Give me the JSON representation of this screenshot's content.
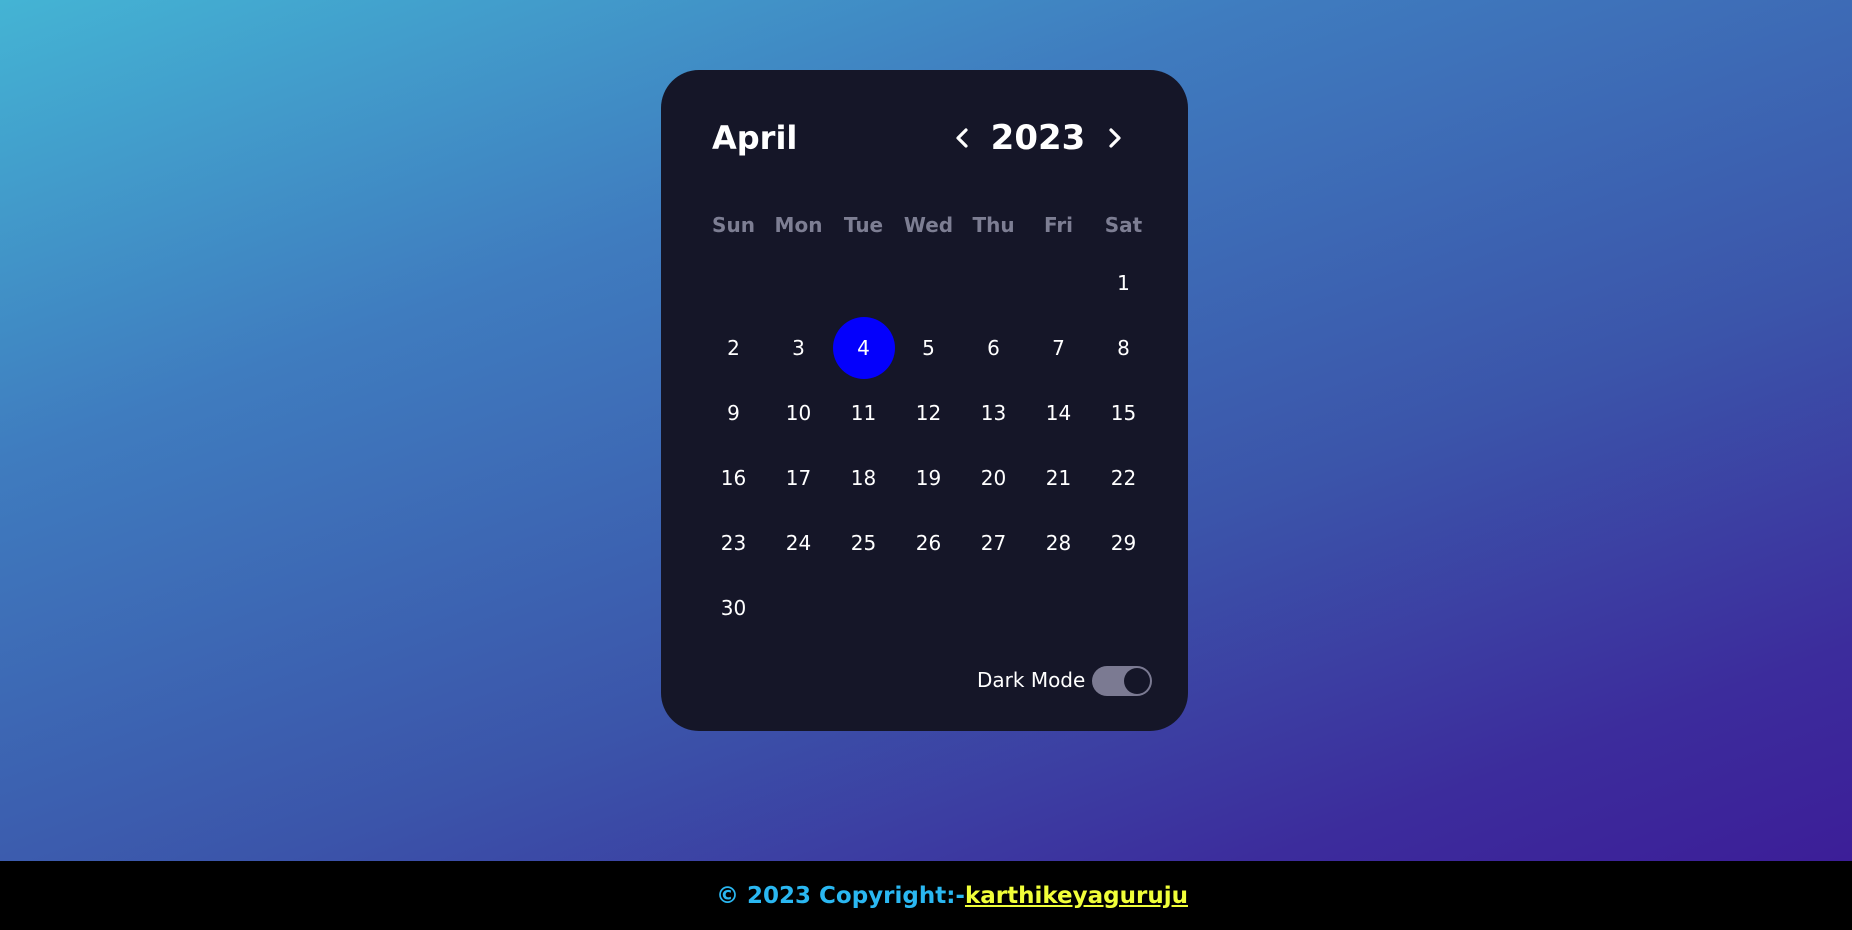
{
  "calendar": {
    "month": "April",
    "year": "2023",
    "prev_icon": "chevron-left-icon",
    "next_icon": "chevron-right-icon",
    "weekdays": [
      "Sun",
      "Mon",
      "Tue",
      "Wed",
      "Thu",
      "Fri",
      "Sat"
    ],
    "weeks": [
      [
        "",
        "",
        "",
        "",
        "",
        "",
        "1"
      ],
      [
        "2",
        "3",
        "4",
        "5",
        "6",
        "7",
        "8"
      ],
      [
        "9",
        "10",
        "11",
        "12",
        "13",
        "14",
        "15"
      ],
      [
        "16",
        "17",
        "18",
        "19",
        "20",
        "21",
        "22"
      ],
      [
        "23",
        "24",
        "25",
        "26",
        "27",
        "28",
        "29"
      ],
      [
        "30",
        "",
        "",
        "",
        "",
        "",
        ""
      ]
    ],
    "today": "4",
    "dark_mode_label": "Dark Mode",
    "dark_mode_enabled": true
  },
  "footer": {
    "copyright_text": "© 2023 Copyright:-",
    "author_link": "karthikeyaguruju"
  },
  "colors": {
    "card_background": "#151628",
    "today_highlight": "#0400fc",
    "weekday_text": "#7d7e93",
    "toggle_track": "#7b7a92",
    "footer_background": "#000000",
    "copyright_text": "#2ab7f1",
    "author_link": "#f1ff39",
    "gradient_start": "#44b4d4",
    "gradient_end": "#3c1e98"
  }
}
